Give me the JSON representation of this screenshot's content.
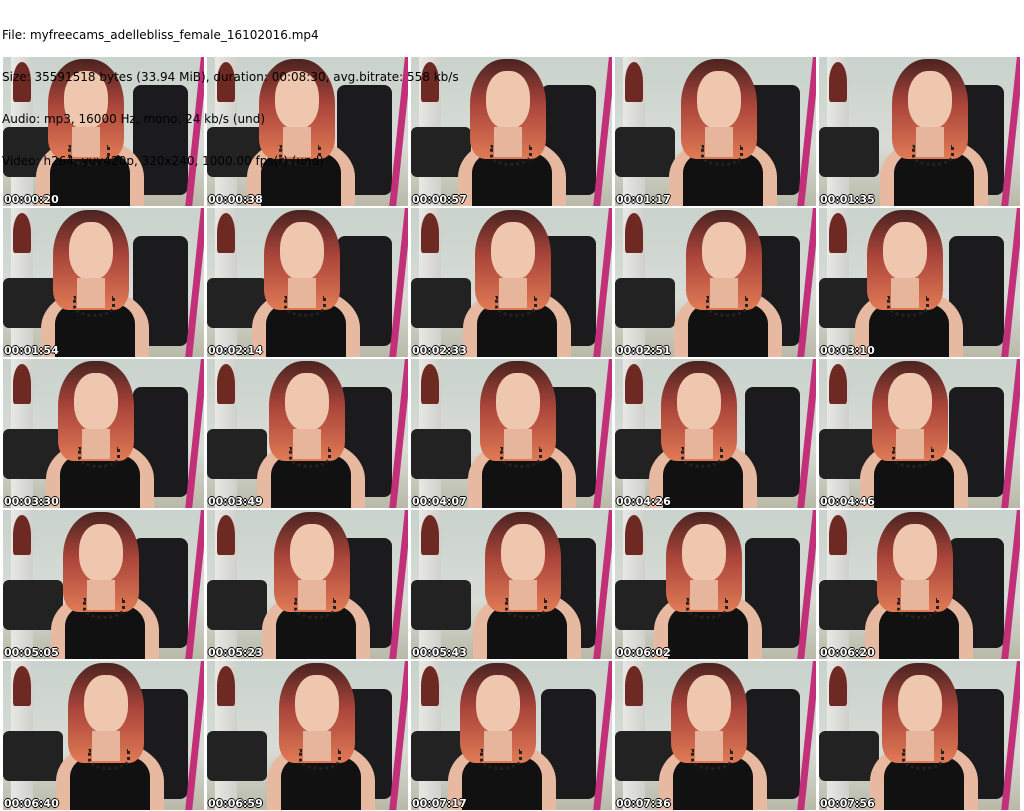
{
  "header": {
    "file": "File: myfreecams_adellebliss_female_16102016.mp4",
    "size": "Size: 35591518 bytes (33.94 MiB), duration: 00:08:30, avg.bitrate: 558 kb/s",
    "audio": "Audio: mp3, 16000 Hz, mono, 24 kb/s (und)",
    "video": "Video: h264, yuv420p, 320x240, 1000.00 fps(r) (und)"
  },
  "thumbnails": [
    "00:00:20",
    "00:00:38",
    "00:00:57",
    "00:01:17",
    "00:01:35",
    "00:01:54",
    "00:02:14",
    "00:02:33",
    "00:02:51",
    "00:03:10",
    "00:03:30",
    "00:03:49",
    "00:04:07",
    "00:04:26",
    "00:04:46",
    "00:05:05",
    "00:05:23",
    "00:05:43",
    "00:06:02",
    "00:06:20",
    "00:06:40",
    "00:06:59",
    "00:07:17",
    "00:07:36",
    "00:07:56"
  ],
  "colors": {
    "pole": "#c2307a",
    "hair": "#e07a55",
    "wall": "#c9d2cc"
  }
}
